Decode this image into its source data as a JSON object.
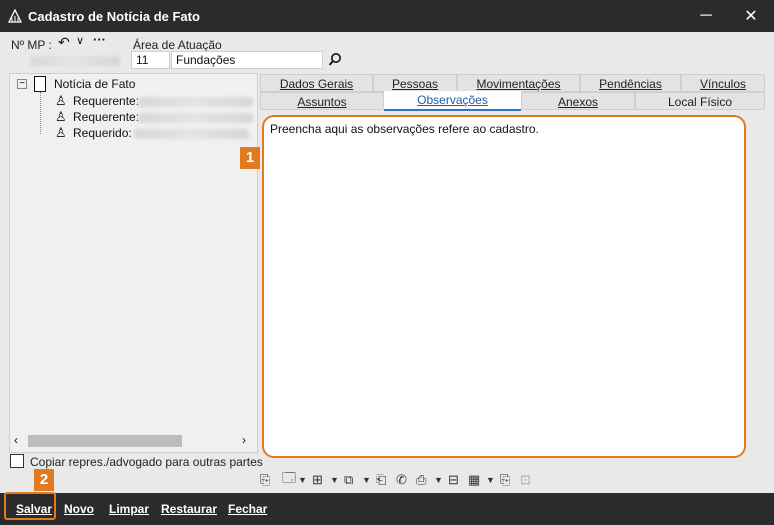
{
  "window": {
    "title": "Cadastro de Notícia de Fato",
    "minimize": "─",
    "close": "✕"
  },
  "header": {
    "mp_label": "Nº MP :",
    "area_label": "Área de Atuação",
    "area_code": "11",
    "area_name": "Fundações",
    "toolbar_icons": [
      "undo-icon",
      "dropdown-icon",
      "more-icon"
    ]
  },
  "tree": {
    "root": "Notícia de Fato",
    "children": [
      {
        "label": "Requerente:"
      },
      {
        "label": "Requerente:"
      },
      {
        "label": "Requerido:"
      }
    ]
  },
  "copy_checkbox": {
    "label": "Copiar repres./advogado para outras partes",
    "checked": false
  },
  "tabs_row1": [
    "Dados Gerais",
    "Pessoas",
    "Movimentações",
    "Pendências",
    "Vínculos"
  ],
  "tabs_row2": [
    "Assuntos",
    "Observações",
    "Anexos",
    "Local Físico"
  ],
  "active_tab": "Observações",
  "observations": {
    "text": "Preencha aqui as observações refere ao cadastro."
  },
  "markers": {
    "m1": "1",
    "m2": "2"
  },
  "footer": {
    "save": "Salvar",
    "new": "Novo",
    "clear": "Limpar",
    "restore": "Restaurar",
    "close": "Fechar"
  },
  "colors": {
    "accent": "#e07b22",
    "titlebar": "#2b2b2b",
    "tab_active": "#2e74c9"
  }
}
